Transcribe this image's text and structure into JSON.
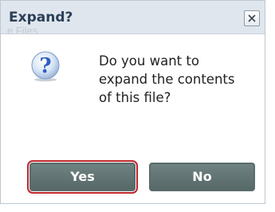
{
  "dialog": {
    "title": "Expand?",
    "background_text_top": "...",
    "background_text_left": "e Files",
    "message": "Do you want to expand the contents of this file?",
    "icon": "question-icon"
  },
  "buttons": {
    "yes_label": "Yes",
    "no_label": "No",
    "close_icon": "close-icon"
  },
  "colors": {
    "title": "#2c3e58",
    "button_fill": "#62757a",
    "focus_outline": "#c0272d",
    "icon_blue": "#2d5fbf"
  }
}
